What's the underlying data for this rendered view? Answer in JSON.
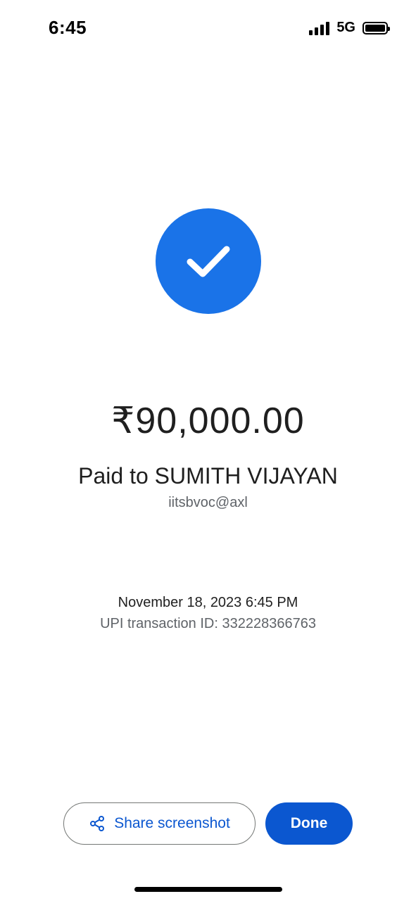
{
  "status_bar": {
    "time": "6:45",
    "network": "5G",
    "icons": [
      "signal-icon",
      "battery-icon"
    ]
  },
  "success": {
    "icon": "checkmark-icon",
    "color": "#1a73e8"
  },
  "payment": {
    "amount": "₹90,000.00",
    "paid_to": "Paid to SUMITH VIJAYAN",
    "upi_id": "iitsbvoc@axl",
    "date_time": "November 18, 2023 6:45 PM",
    "transaction_id": "UPI transaction ID: 332228366763"
  },
  "actions": {
    "share_label": "Share screenshot",
    "share_icon": "share-icon",
    "done_label": "Done",
    "accent": "#0b57d0"
  }
}
